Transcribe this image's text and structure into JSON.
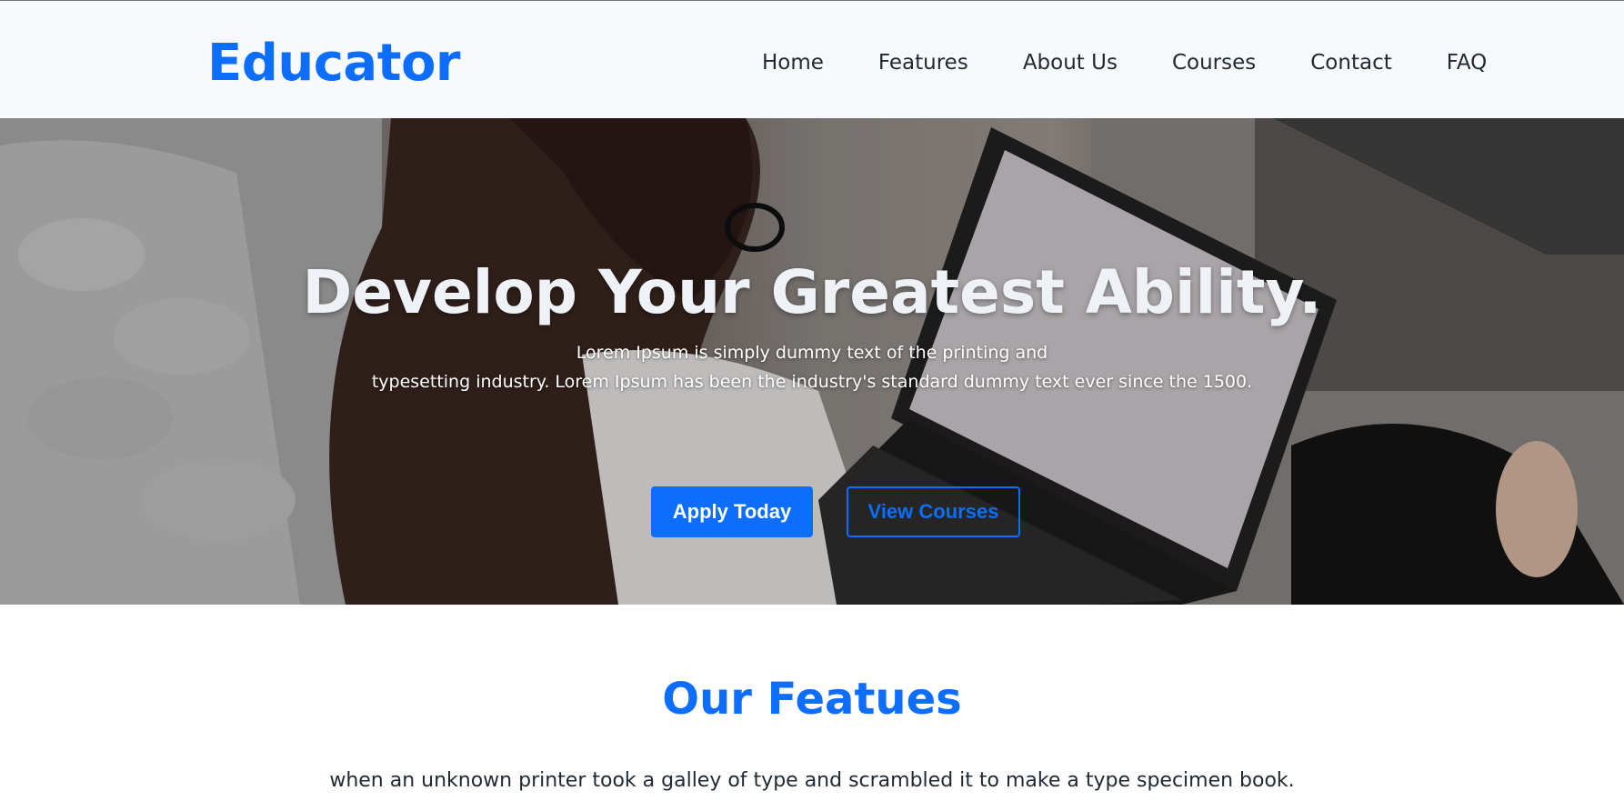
{
  "nav": {
    "brand": "Educator",
    "links": [
      "Home",
      "Features",
      "About Us",
      "Courses",
      "Contact",
      "FAQ"
    ]
  },
  "hero": {
    "title": "Develop Your Greatest Ability.",
    "text_line1": "Lorem Ipsum is simply dummy text of the printing and",
    "text_line2": "typesetting industry. Lorem Ipsum has been the industry's standard dummy text ever since the 1500.",
    "apply_label": "Apply Today",
    "courses_label": "View Courses",
    "image": "woman-using-laptop-photo"
  },
  "features": {
    "title": "Our Featues",
    "text": "when an unknown printer took a galley of type and scrambled it to make a type specimen book."
  },
  "colors": {
    "accent": "#0d6efd",
    "navbar_bg": "#f8f9fa"
  }
}
